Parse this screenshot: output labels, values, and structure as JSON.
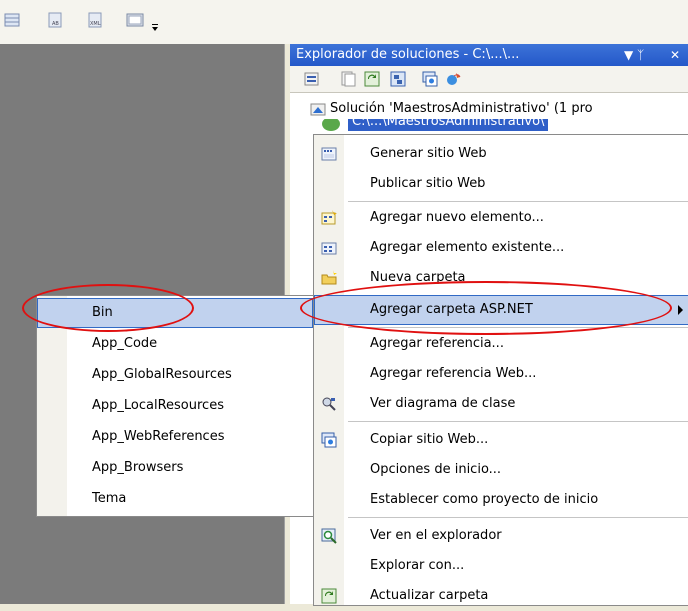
{
  "panel": {
    "title": "Explorador de soluciones - C:\\...\\...",
    "pin_glyph": "▼  ᛉ",
    "close_glyph": "✕"
  },
  "tree": {
    "solution": "Solución 'MaestrosAdministrativo' (1 pro",
    "project": "C:\\...\\MaestrosAdministrativo\\"
  },
  "context_menu": {
    "items": [
      {
        "label": "Generar sitio Web",
        "icon": "build-web-icon"
      },
      {
        "label": "Publicar sitio Web",
        "icon": ""
      },
      {
        "label": "Agregar nuevo elemento...",
        "icon": "add-new-item-icon"
      },
      {
        "label": "Agregar elemento existente...",
        "icon": "add-existing-item-icon"
      },
      {
        "label": "Nueva carpeta",
        "icon": "new-folder-icon"
      },
      {
        "label": "Agregar carpeta ASP.NET",
        "icon": "",
        "highlighted": true,
        "submenu": true
      },
      {
        "label": "Agregar referencia...",
        "icon": ""
      },
      {
        "label": "Agregar referencia Web...",
        "icon": ""
      },
      {
        "label": "Ver diagrama de clase",
        "icon": "class-diagram-icon"
      },
      {
        "label": "Copiar sitio Web...",
        "icon": "copy-web-icon"
      },
      {
        "label": "Opciones de inicio...",
        "icon": ""
      },
      {
        "label": "Establecer como proyecto de inicio",
        "icon": ""
      },
      {
        "label": "Ver en el explorador",
        "icon": "view-in-browser-icon"
      },
      {
        "label": "Explorar con...",
        "icon": ""
      },
      {
        "label": "Actualizar carpeta",
        "icon": "refresh-folder-icon"
      }
    ]
  },
  "submenu": {
    "items": [
      {
        "label": "Bin",
        "highlighted": true
      },
      {
        "label": "App_Code"
      },
      {
        "label": "App_GlobalResources"
      },
      {
        "label": "App_LocalResources"
      },
      {
        "label": "App_WebReferences"
      },
      {
        "label": "App_Browsers"
      },
      {
        "label": "Tema"
      }
    ]
  },
  "colors": {
    "title_bar": "#2458c9",
    "highlight": "#c1d2ee",
    "annotation": "#e01010"
  }
}
